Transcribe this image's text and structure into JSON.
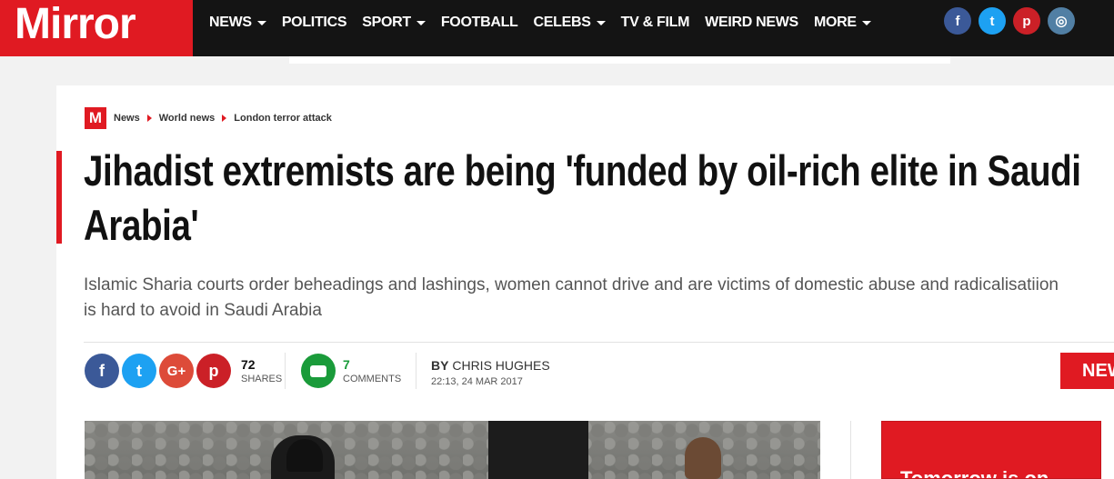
{
  "brand": {
    "logo_text": "Mirror",
    "accent": "#e01a22",
    "nav_bg": "#141414"
  },
  "nav": {
    "items": [
      {
        "label": "NEWS",
        "dropdown": true
      },
      {
        "label": "POLITICS",
        "dropdown": false
      },
      {
        "label": "SPORT",
        "dropdown": true
      },
      {
        "label": "FOOTBALL",
        "dropdown": false
      },
      {
        "label": "CELEBS",
        "dropdown": true
      },
      {
        "label": "TV & FILM",
        "dropdown": false
      },
      {
        "label": "WEIRD NEWS",
        "dropdown": false
      },
      {
        "label": "MORE",
        "dropdown": true
      }
    ],
    "social": [
      {
        "icon": "facebook-icon",
        "glyph": "f",
        "color": "#3b5998"
      },
      {
        "icon": "twitter-icon",
        "glyph": "t",
        "color": "#1da1f2"
      },
      {
        "icon": "pinterest-icon",
        "glyph": "p",
        "color": "#cb2027"
      },
      {
        "icon": "instagram-icon",
        "glyph": "◎",
        "color": "#517fa4"
      }
    ]
  },
  "breadcrumb": {
    "badge": "M",
    "items": [
      "News",
      "World news",
      "London terror attack"
    ]
  },
  "article": {
    "headline": "Jihadist extremists are being 'funded by oil-rich elite in Saudi Arabia'",
    "standfirst": "Islamic Sharia courts order beheadings and lashings, women cannot drive and are victims of domestic abuse and radicalisatiion is hard to avoid in Saudi Arabia",
    "shares": {
      "count": "72",
      "label": "SHARES"
    },
    "comments": {
      "count": "7",
      "label": "COMMENTS"
    },
    "byline": {
      "prefix": "BY",
      "author": "CHRIS HUGHES",
      "date": "22:13, 24 MAR 2017"
    },
    "share_buttons": [
      {
        "icon": "facebook-icon",
        "glyph": "f",
        "color": "#3b5998"
      },
      {
        "icon": "twitter-icon",
        "glyph": "t",
        "color": "#1da1f2"
      },
      {
        "icon": "google-plus-icon",
        "glyph": "G+",
        "color": "#dd4b39"
      },
      {
        "icon": "pinterest-icon",
        "glyph": "p",
        "color": "#cb2027"
      }
    ]
  },
  "right_badge": {
    "text": "NEW"
  },
  "side_promo": {
    "text": "Tomorrow is on"
  }
}
